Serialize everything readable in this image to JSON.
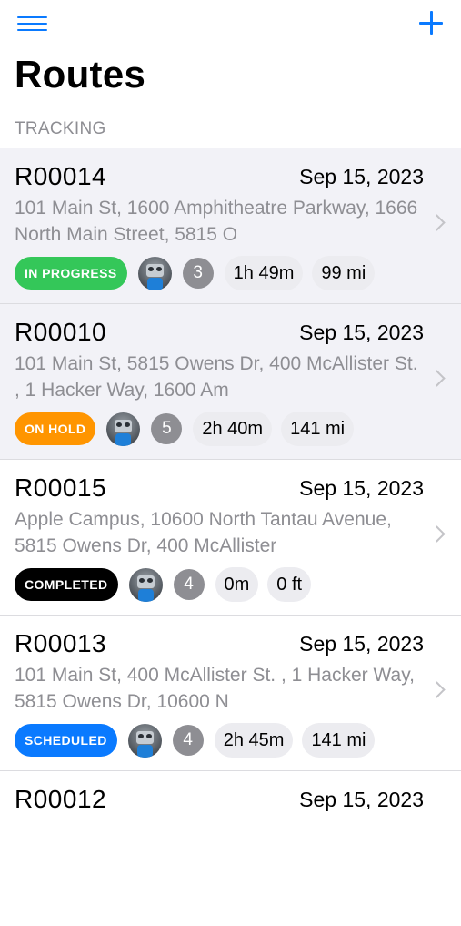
{
  "header": {
    "title": "Routes",
    "section": "TRACKING"
  },
  "icons": {
    "menu": "hamburger-menu-icon",
    "add": "plus-icon",
    "chevron": "chevron-right-icon",
    "avatar": "robot-avatar"
  },
  "colors": {
    "accent": "#0A7AFF",
    "in_progress": "#34C759",
    "on_hold": "#FF9500",
    "completed": "#000000",
    "scheduled": "#0A7AFF"
  },
  "routes": [
    {
      "id": "R00014",
      "date": "Sep 15, 2023",
      "address": "101 Main St, 1600 Amphitheatre Parkway, 1666 North Main Street, 5815 O",
      "status": "IN PROGRESS",
      "stops": "3",
      "duration": "1h 49m",
      "distance": "99 mi"
    },
    {
      "id": "R00010",
      "date": "Sep 15, 2023",
      "address": "101 Main St, 5815 Owens Dr, 400 McAllister St. , 1 Hacker Way, 1600 Am",
      "status": "ON HOLD",
      "stops": "5",
      "duration": "2h 40m",
      "distance": "141 mi"
    },
    {
      "id": "R00015",
      "date": "Sep 15, 2023",
      "address": "Apple Campus, 10600 North Tantau Avenue, 5815 Owens Dr, 400 McAllister",
      "status": "COMPLETED",
      "stops": "4",
      "duration": "0m",
      "distance": "0 ft"
    },
    {
      "id": "R00013",
      "date": "Sep 15, 2023",
      "address": "101 Main St, 400 McAllister St. , 1 Hacker Way, 5815 Owens Dr, 10600 N",
      "status": "SCHEDULED",
      "stops": "4",
      "duration": "2h 45m",
      "distance": "141 mi"
    },
    {
      "id": "R00012",
      "date": "Sep 15, 2023"
    }
  ]
}
